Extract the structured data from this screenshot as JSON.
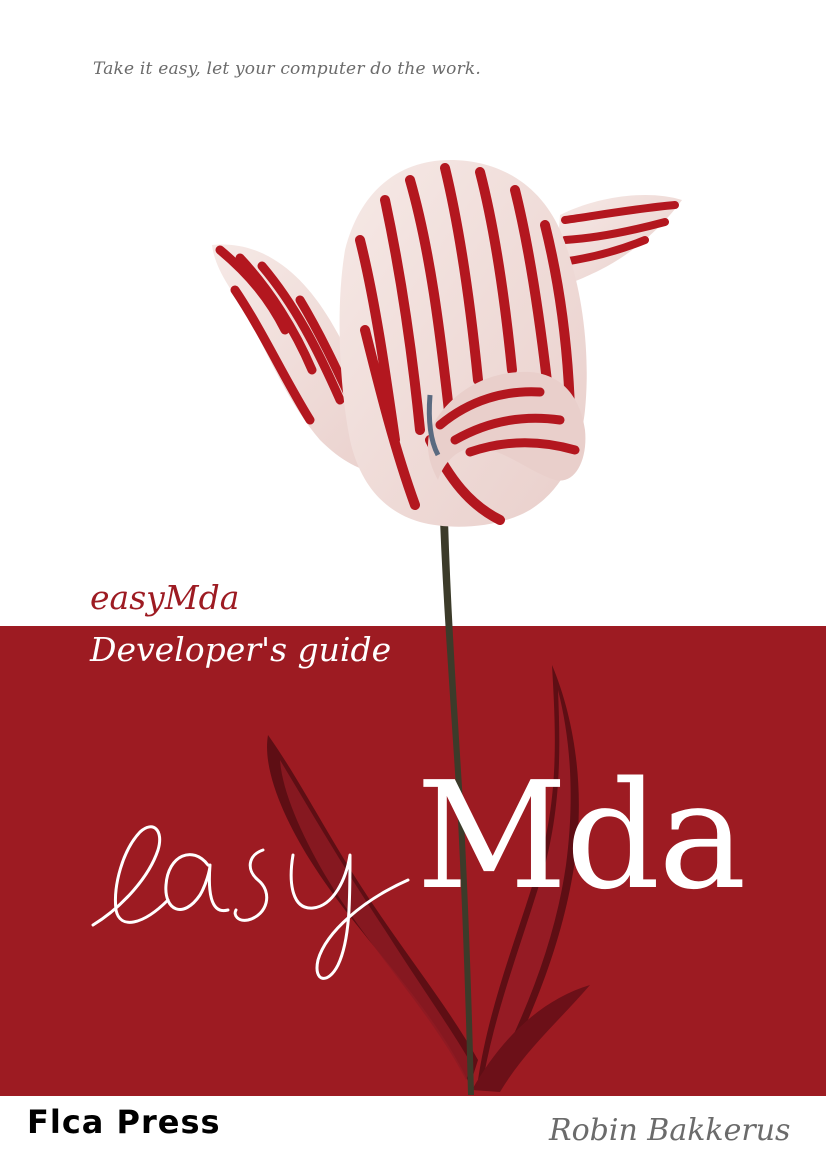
{
  "cover": {
    "tagline": "Take it easy, let your computer do the work.",
    "title_line_1": "easyMda",
    "title_line_2": "Developer's guide",
    "logo_script_part": "easy",
    "logo_bold_part": "Mda",
    "publisher": "Flca Press",
    "author": "Robin Bakkerus"
  },
  "colors": {
    "band": "#9d1b22",
    "tagline": "#6b6b6b",
    "author": "#6b6b6b",
    "title_line_1": "#9d1b22",
    "title_line_2": "#ffffff",
    "logo": "#ffffff",
    "publisher": "#000000"
  },
  "illustration": {
    "subject": "red-and-white-striped-tulip"
  }
}
